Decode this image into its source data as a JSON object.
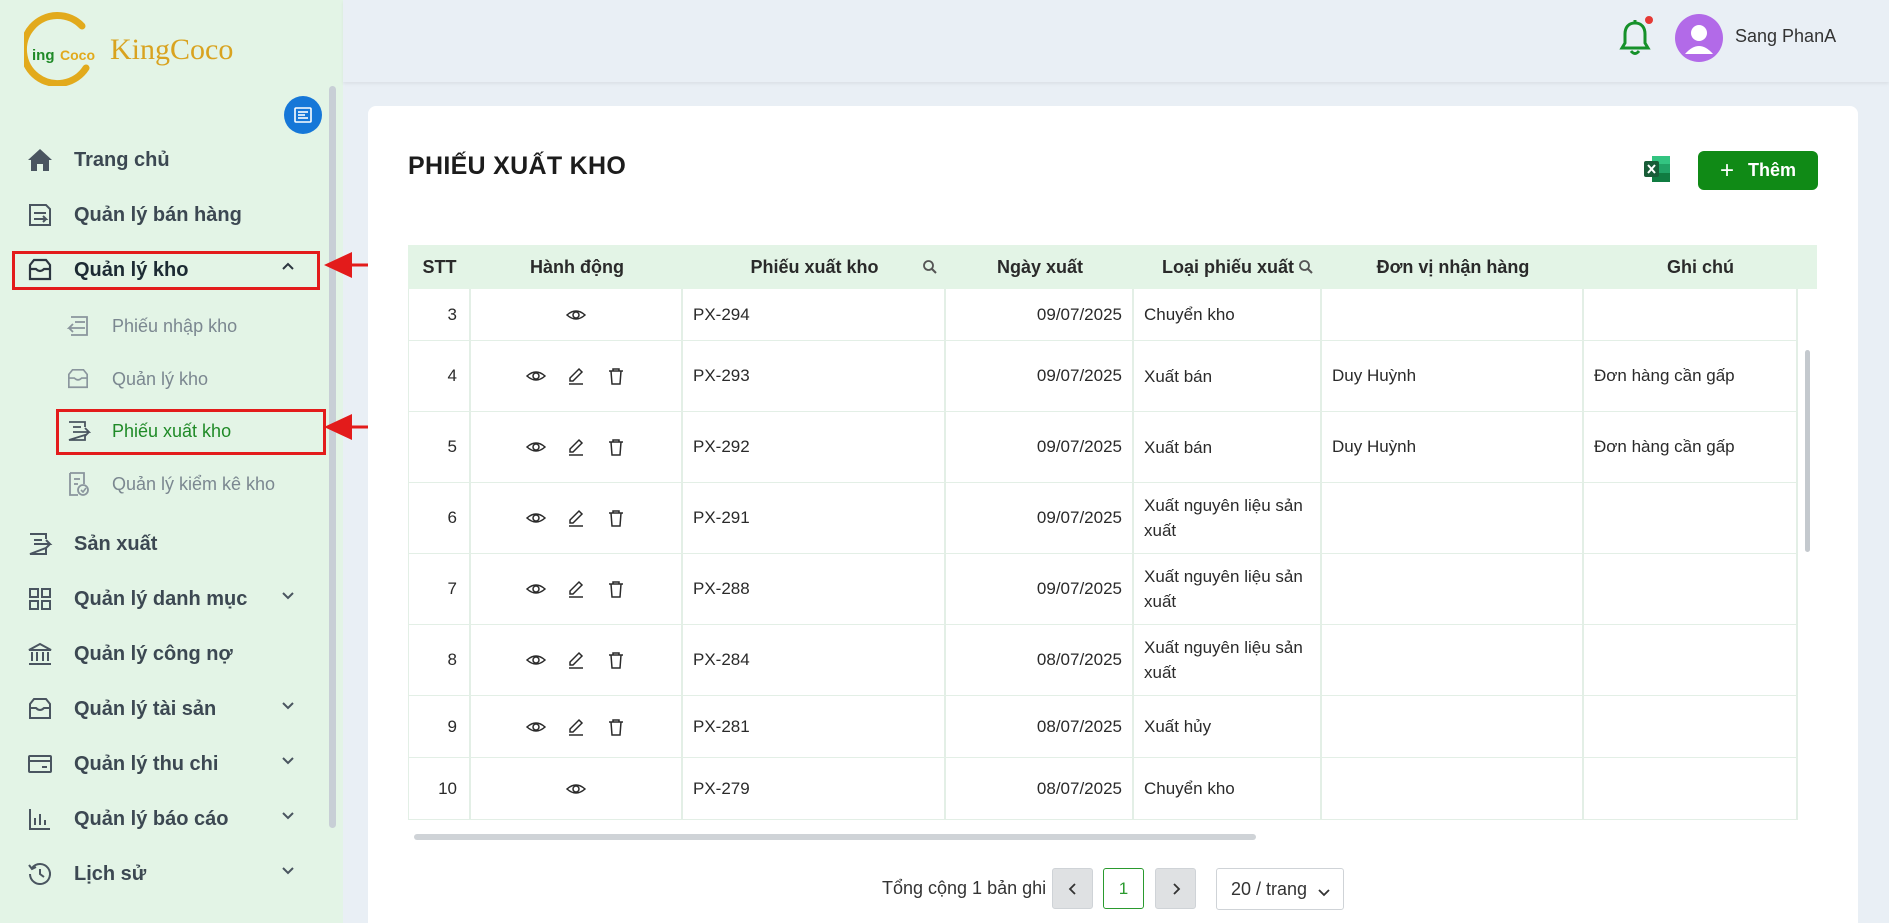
{
  "brand": {
    "name": "KingCoco",
    "logo_text": "KingCoco"
  },
  "colors": {
    "accent": "#108a16",
    "sidebar_bg": "#e3f4e6",
    "highlight": "#e31b1b",
    "collapse": "#1677d8"
  },
  "sidebar": {
    "items": [
      {
        "label": "Trang chủ",
        "icon": "home-icon"
      },
      {
        "label": "Quản lý bán hàng",
        "icon": "sales-icon"
      },
      {
        "label": "Quản lý kho",
        "icon": "warehouse-icon",
        "expanded": true
      },
      {
        "label": "Sản xuất",
        "icon": "production-icon"
      },
      {
        "label": "Quản lý danh mục",
        "icon": "grid-icon"
      },
      {
        "label": "Quản lý công nợ",
        "icon": "bank-icon"
      },
      {
        "label": "Quản lý tài sản",
        "icon": "box-icon"
      },
      {
        "label": "Quản lý thu chi",
        "icon": "wallet-icon"
      },
      {
        "label": "Quản lý báo cáo",
        "icon": "report-icon"
      },
      {
        "label": "Lịch sử",
        "icon": "history-icon"
      }
    ],
    "sub_items": [
      {
        "label": "Phiếu nhập kho",
        "icon": "import-icon"
      },
      {
        "label": "Quản lý kho",
        "icon": "warehouse-icon"
      },
      {
        "label": "Phiếu xuất kho",
        "icon": "export-icon",
        "active": true
      },
      {
        "label": "Quản lý kiểm kê kho",
        "icon": "inventory-check-icon"
      }
    ]
  },
  "header": {
    "username": "Sang PhanA"
  },
  "page": {
    "title": "PHIẾU XUẤT KHO",
    "add_label": "Thêm"
  },
  "table": {
    "columns": [
      "STT",
      "Hành động",
      "Phiếu xuất kho",
      "Ngày xuất",
      "Loại phiếu xuất",
      "Đơn vị nhận hàng",
      "Ghi chú"
    ],
    "rows": [
      {
        "stt": "3",
        "actions": [
          "view"
        ],
        "code": "PX-294",
        "date": "09/07/2025",
        "type": "Chuyển kho",
        "receiver": "",
        "note": ""
      },
      {
        "stt": "4",
        "actions": [
          "view",
          "edit",
          "delete"
        ],
        "code": "PX-293",
        "date": "09/07/2025",
        "type": "Xuất bán",
        "receiver": "Duy Huỳnh",
        "note": "Đơn hàng cần gấp"
      },
      {
        "stt": "5",
        "actions": [
          "view",
          "edit",
          "delete"
        ],
        "code": "PX-292",
        "date": "09/07/2025",
        "type": "Xuất bán",
        "receiver": "Duy Huỳnh",
        "note": "Đơn hàng cần gấp"
      },
      {
        "stt": "6",
        "actions": [
          "view",
          "edit",
          "delete"
        ],
        "code": "PX-291",
        "date": "09/07/2025",
        "type": "Xuất nguyên liệu sản xuất",
        "receiver": "",
        "note": ""
      },
      {
        "stt": "7",
        "actions": [
          "view",
          "edit",
          "delete"
        ],
        "code": "PX-288",
        "date": "09/07/2025",
        "type": "Xuất nguyên liệu sản xuất",
        "receiver": "",
        "note": ""
      },
      {
        "stt": "8",
        "actions": [
          "view",
          "edit",
          "delete"
        ],
        "code": "PX-284",
        "date": "08/07/2025",
        "type": "Xuất nguyên liệu sản xuất",
        "receiver": "",
        "note": ""
      },
      {
        "stt": "9",
        "actions": [
          "view",
          "edit",
          "delete"
        ],
        "code": "PX-281",
        "date": "08/07/2025",
        "type": "Xuất hủy",
        "receiver": "",
        "note": ""
      },
      {
        "stt": "10",
        "actions": [
          "view"
        ],
        "code": "PX-279",
        "date": "08/07/2025",
        "type": "Chuyển kho",
        "receiver": "",
        "note": ""
      }
    ]
  },
  "pagination": {
    "total_label": "Tổng cộng 1 bản ghi",
    "current_page": "1",
    "page_size": "20 / trang"
  }
}
